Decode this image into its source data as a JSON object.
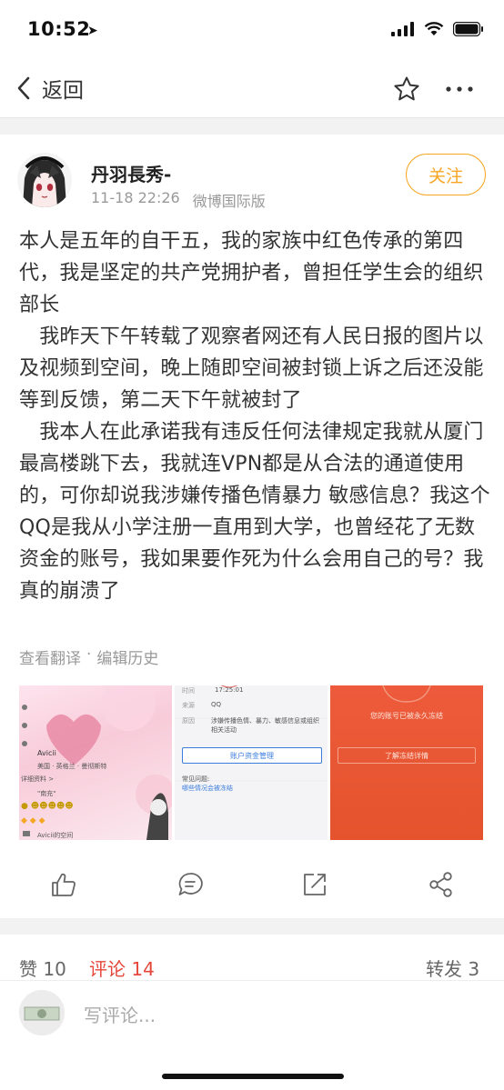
{
  "status_bar": {
    "time": "10:52"
  },
  "nav": {
    "back_label": "返回"
  },
  "post": {
    "username": "丹羽長秀-",
    "timestamp": "11-18 22:26",
    "source": "微博国际版",
    "follow_label": "关注",
    "paragraphs": [
      "本人是五年的自干五，我的家族中红色传承的第四代，我是坚定的共产党拥护者，曾担任学生会的组织部长",
      "　我昨天下午转载了观察者网还有人民日报的图片以及视频到空间，晚上随即空间被封锁上诉之后还没能等到反馈，第二天下午就被封了",
      "　我本人在此承诺我有违反任何法律规定我就从厦门最高楼跳下去，我就连VPN都是从合法的通道使用的，可你却说我涉嫌传播色情暴力 敏感信息？我这个QQ是我从小学注册一直用到大学，也曾经花了无数资金的账号，我如果要作死为什么会用自己的号？我真的崩溃了"
    ],
    "translate_label": "查看翻译",
    "separator": "·",
    "edit_history_label": "编辑历史",
    "images": {
      "img1": {
        "name": "Avicii",
        "location": "美国 · 英格兰 · 曼彻斯特",
        "details": "详细资料 >",
        "tag": "\"南充\"",
        "space": "Avicii的空间"
      },
      "img2": {
        "time_label": "时间",
        "time_value": "17:25:01",
        "source_label": "来源",
        "source_value": "QQ",
        "reason_label": "原因",
        "reason_value": "涉嫌传播色情、暴力、敏感信息或组织相关活动",
        "button": "账户资金管理",
        "faq": "常见问题:",
        "faq_link": "哪些情况会被冻结"
      },
      "img3": {
        "message": "您的账号已被永久冻结",
        "button": "了解冻结详情"
      }
    }
  },
  "tabs": {
    "likes": "赞 10",
    "comments": "评论 14",
    "reposts": "转发 3"
  },
  "comment_bar": {
    "placeholder": "写评论..."
  },
  "colors": {
    "accent": "#f6a623",
    "active_tab": "#e5473a"
  }
}
